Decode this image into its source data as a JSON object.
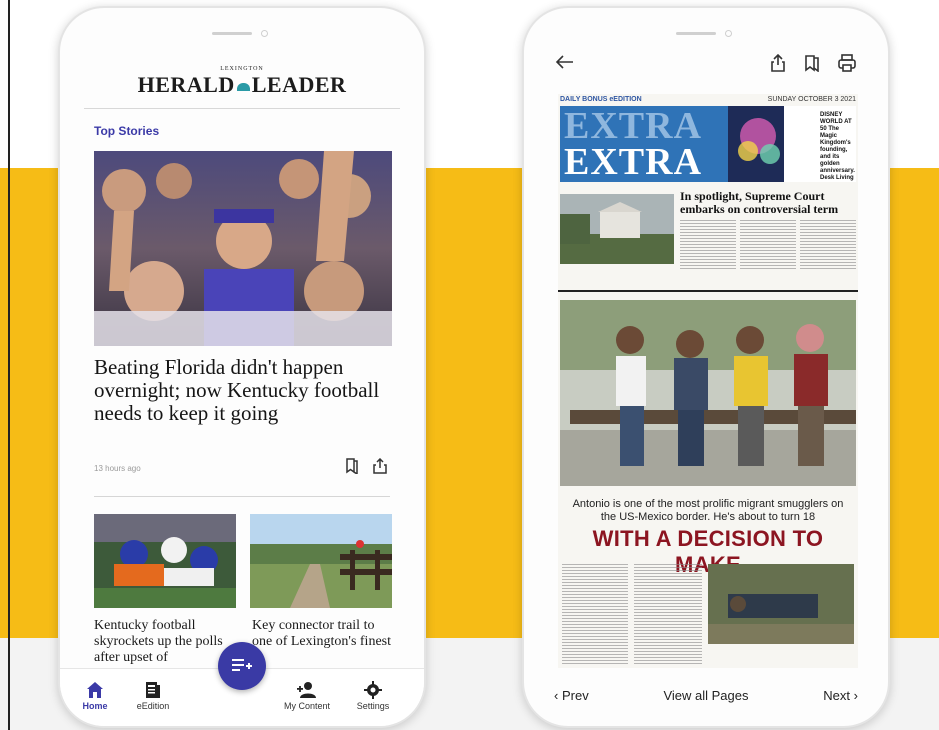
{
  "colors": {
    "accent_band": "#f6bc16",
    "brand_purple": "#3b3aa7",
    "headline_red": "#8c1521",
    "extra_blue": "#2f73b7"
  },
  "left_phone": {
    "masthead_small": "LEXINGTON",
    "masthead_left": "HERALD",
    "masthead_right": "LEADER",
    "section_label": "Top Stories",
    "hero_headline": "Beating Florida didn't happen overnight; now Kentucky football needs to keep it going",
    "hero_timestamp": "13 hours ago",
    "cards": [
      {
        "title": "Kentucky football skyrockets up the polls after upset of"
      },
      {
        "title": "Key connector trail to one of Lexington's finest"
      }
    ],
    "nav": {
      "home": "Home",
      "edition": "eEdition",
      "my_content": "My Content",
      "settings": "Settings"
    },
    "icons": [
      "bookmark-icon",
      "share-icon",
      "home-icon",
      "newspaper-icon",
      "add-to-list-icon",
      "add-person-icon",
      "gear-icon"
    ]
  },
  "right_phone": {
    "edition_label": "DAILY BONUS eEDITION",
    "edition_date": "SUNDAY OCTOBER 3 2021",
    "extra_word": "EXTRA",
    "disney_teaser": "DISNEY WORLD AT 50 The Magic Kingdom's founding, and its golden anniversary. Desk Living",
    "court_headline": "In spotlight, Supreme Court embarks on controversial term",
    "deck": "Antonio is one of the most prolific migrant smugglers on the US-Mexico border. He's about to turn 18",
    "main_headline": "WITH A DECISION TO MAKE",
    "pager": {
      "prev": "Prev",
      "view_all": "View all Pages",
      "next": "Next"
    },
    "icons": [
      "back-arrow-icon",
      "share-icon",
      "bookmark-icon",
      "print-icon",
      "chevron-left-icon",
      "chevron-right-icon"
    ]
  }
}
